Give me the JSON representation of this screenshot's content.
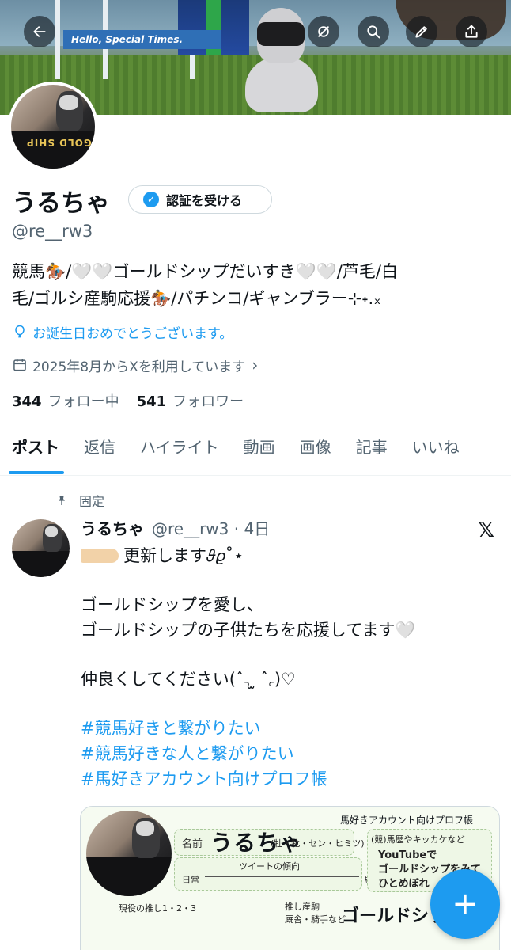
{
  "banner": {
    "sign_text": "Hello, Special Times."
  },
  "header": {
    "back_icon": "arrow-left-icon",
    "grok_icon": "grok-icon",
    "search_icon": "search-icon",
    "edit_icon": "pencil-icon",
    "share_icon": "share-icon"
  },
  "profile": {
    "name": "うるちゃ",
    "verify_button_label": "認証を受ける",
    "verify_badge": "✓",
    "handle": "@re__rw3",
    "bio_line1": "競馬🏇/🤍🤍ゴールドシップだいすき🤍🤍/芦毛/白",
    "bio_line2": "毛/ゴルシ産駒応援🏇/パチンコ/ギャンブラー⊹˖.ₓ",
    "birthday": "お誕生日おめでとうございます。",
    "joined": "2025年8月からXを利用しています",
    "joined_chevron": "›",
    "following_count": "344",
    "following_label": "フォロー中",
    "followers_count": "541",
    "followers_label": "フォロワー"
  },
  "tabs": [
    {
      "label": "ポスト"
    },
    {
      "label": "返信"
    },
    {
      "label": "ハイライト"
    },
    {
      "label": "動画"
    },
    {
      "label": "画像"
    },
    {
      "label": "記事"
    },
    {
      "label": "いいね"
    }
  ],
  "post": {
    "pinned_label": "固定",
    "author_name": "うるちゃ",
    "meta": "@re__rw3 · 4日",
    "platform_mark": "𝕏",
    "line1": "更新します𝜗𝜚˚⋆",
    "line2": "ゴールドシップを愛し、",
    "line3": "ゴールドシップの子供たちを応援してます🤍",
    "line4": "仲良くしてください(ˆ꜆ ̫ ˆ꜀)♡",
    "hashtags": [
      "#競馬好きと繋がりたい",
      "#競馬好きな人と繋がりたい",
      "#馬好きアカウント向けプロフ帳"
    ]
  },
  "card": {
    "title": "馬好きアカウント向けプロフ帳",
    "name_label": "名前",
    "name_value": "うるちゃ",
    "gender": "(牡・牝・セン・ヒミツ)",
    "tweet_trend": "ツイートの傾向",
    "daily": "日常",
    "horse": "馬",
    "history": "(競)馬歴やキッカケなど",
    "youtube1": "YouTubeで",
    "youtube2": "ゴールドシップをみて",
    "youtube3": "ひとめぼれ",
    "current": "現役の推し1・2・3",
    "sire": "推し産駒",
    "sire_sub": "厩舎・騎手など",
    "gold": "ゴールドシッ"
  },
  "fab": {
    "label": "+"
  }
}
